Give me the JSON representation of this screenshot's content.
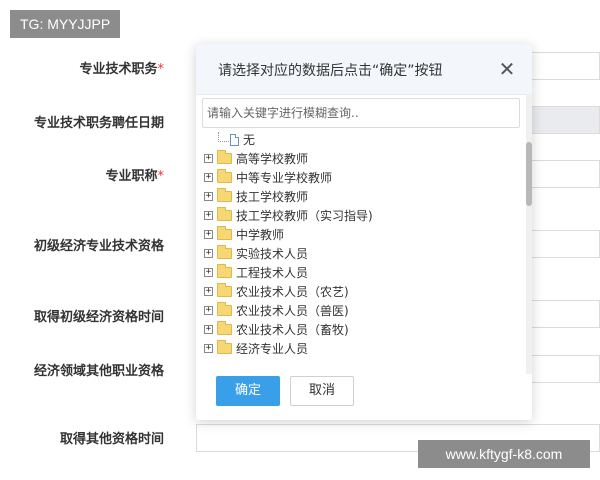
{
  "watermarks": {
    "top_left": "TG: MYYJJPP",
    "bottom_right": "www.kftygf-k8.com"
  },
  "form": {
    "fields": [
      {
        "label": "专业技术职务",
        "required": true
      },
      {
        "label": "专业技术职务聘任日期",
        "required": false
      },
      {
        "label": "专业职称",
        "required": true
      },
      {
        "label": "初级经济专业技术资格",
        "required": false
      },
      {
        "label": "取得初级经济资格时间",
        "required": false
      },
      {
        "label": "经济领域其他职业资格",
        "required": false
      },
      {
        "label": "取得其他资格时间",
        "required": false
      }
    ],
    "required_mark": "*"
  },
  "dialog": {
    "title": "请选择对应的数据后点击“确定”按钮",
    "close_icon": "close-icon",
    "search_placeholder": "请输入关键字进行模糊查询..",
    "tree": {
      "root_label": "无",
      "root_icon": "file-icon",
      "items": [
        "高等学校教师",
        "中等专业学校教师",
        "技工学校教师",
        "技工学校教师（实习指导)",
        "中学教师",
        "实验技术人员",
        "工程技术人员",
        "农业技术人员（农艺)",
        "农业技术人员（兽医)",
        "农业技术人员（畜牧)",
        "经济专业人员"
      ],
      "expander_symbol": "+",
      "item_icon": "folder-icon"
    },
    "confirm_label": "确定",
    "cancel_label": "取消"
  },
  "colors": {
    "primary": "#3a9fe9",
    "required": "#ee3333",
    "folder": "#f7d774",
    "watermark_bg": "#8c8c8c"
  }
}
